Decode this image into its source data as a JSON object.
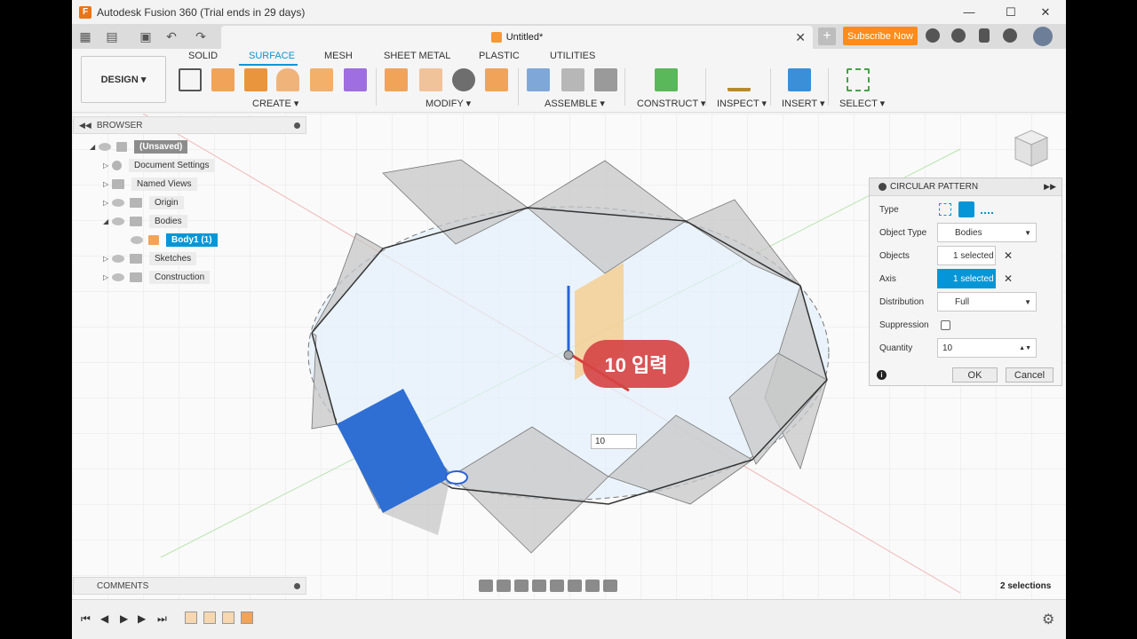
{
  "window": {
    "title": "Autodesk Fusion 360 (Trial ends in 29 days)",
    "controls": [
      "—",
      "☐",
      "✕"
    ]
  },
  "document_tab": {
    "title": "Untitled*",
    "close": "✕",
    "subscribe": "Subscribe Now"
  },
  "ribbon": {
    "design_label": "DESIGN ▾",
    "tabs": [
      "SOLID",
      "SURFACE",
      "MESH",
      "SHEET METAL",
      "PLASTIC",
      "UTILITIES"
    ],
    "active_tab": "SURFACE",
    "groups": [
      "CREATE ▾",
      "MODIFY ▾",
      "ASSEMBLE ▾",
      "CONSTRUCT ▾",
      "INSPECT ▾",
      "INSERT ▾",
      "SELECT ▾"
    ]
  },
  "browser": {
    "title": "BROWSER",
    "items": [
      {
        "label": "(Unsaved)"
      },
      {
        "label": "Document Settings"
      },
      {
        "label": "Named Views"
      },
      {
        "label": "Origin"
      },
      {
        "label": "Bodies"
      },
      {
        "label": "Body1 (1)"
      },
      {
        "label": "Sketches"
      },
      {
        "label": "Construction"
      }
    ]
  },
  "dialog": {
    "title": "CIRCULAR PATTERN",
    "type_label": "Type",
    "object_type_label": "Object Type",
    "object_type_value": "Bodies",
    "objects_label": "Objects",
    "objects_value": "1 selected",
    "axis_label": "Axis",
    "axis_value": "1 selected",
    "distribution_label": "Distribution",
    "distribution_value": "Full",
    "suppression_label": "Suppression",
    "quantity_label": "Quantity",
    "quantity_value": "10",
    "ok": "OK",
    "cancel": "Cancel",
    "info": "i"
  },
  "viewport": {
    "inline_quantity": "10",
    "callout": "10 입력"
  },
  "comments": {
    "title": "COMMENTS"
  },
  "status": {
    "selections": "2 selections"
  },
  "colors": {
    "accent": "#0696d7",
    "subscribe": "#ff8c1a",
    "callout": "#d64545",
    "body_blue": "#2f6fd4",
    "surface_fill": "#c7c7c7"
  }
}
